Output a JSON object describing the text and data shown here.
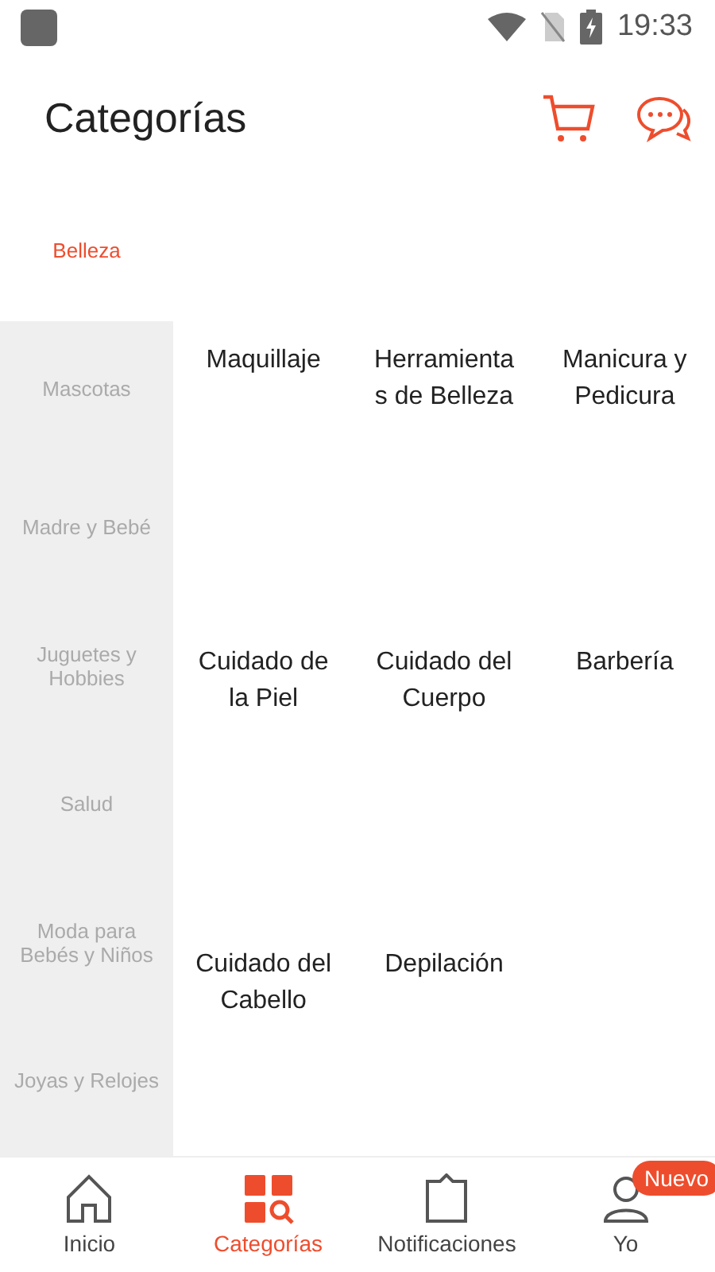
{
  "status_bar": {
    "time": "19:33"
  },
  "header": {
    "title": "Categorías"
  },
  "sidebar": {
    "items": [
      {
        "label": "Belleza",
        "selected": true
      },
      {
        "label": "Mascotas",
        "selected": false
      },
      {
        "label": "Madre y Bebé",
        "selected": false
      },
      {
        "label": "Juguetes y Hobbies",
        "selected": false
      },
      {
        "label": "Salud",
        "selected": false
      },
      {
        "label": "Moda para Bebés y Niños",
        "selected": false
      },
      {
        "label": "Joyas y Relojes",
        "selected": false
      }
    ]
  },
  "subcategories": [
    {
      "label": "Maquillaje"
    },
    {
      "label": "Herramientas de Belleza"
    },
    {
      "label": "Manicura y Pedicura"
    },
    {
      "label": "Cuidado de la Piel"
    },
    {
      "label": "Cuidado del Cuerpo"
    },
    {
      "label": "Barbería"
    },
    {
      "label": "Cuidado del Cabello"
    },
    {
      "label": "Depilación"
    }
  ],
  "bottom_nav": [
    {
      "kind": "home",
      "label": "Inicio",
      "selected": false
    },
    {
      "kind": "categories",
      "label": "Categorías",
      "selected": true
    },
    {
      "kind": "notifications",
      "label": "Notificaciones",
      "selected": false
    },
    {
      "kind": "profile",
      "label": "Yo",
      "selected": false,
      "badge": "Nuevo"
    }
  ]
}
